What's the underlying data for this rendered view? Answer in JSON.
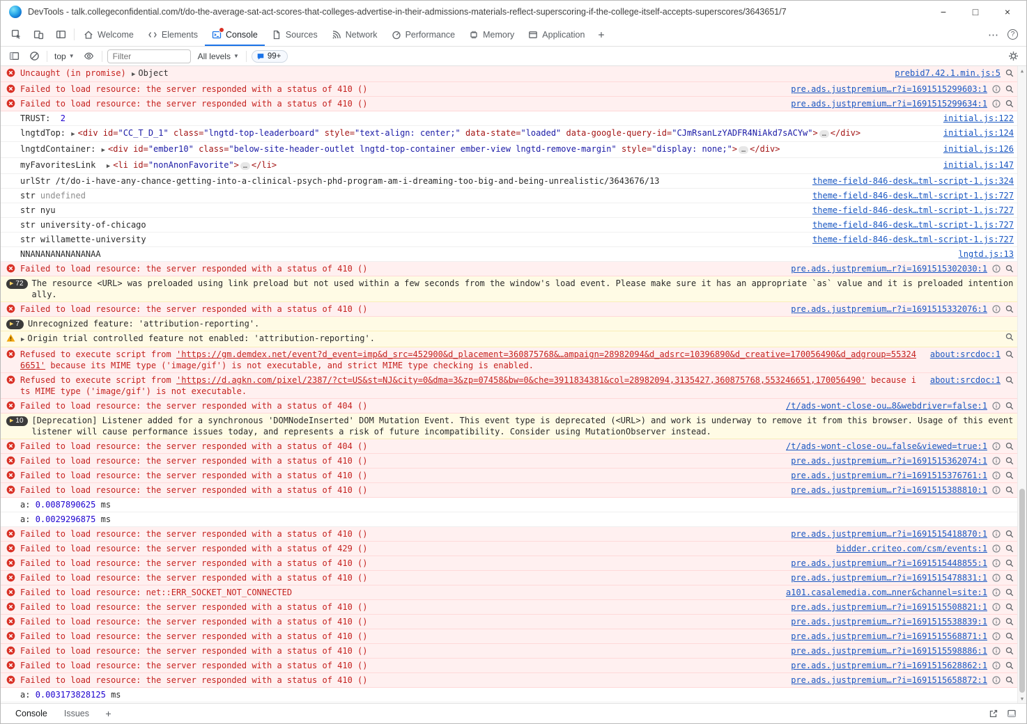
{
  "window": {
    "title": "DevTools - talk.collegeconfidential.com/t/do-the-average-sat-act-scores-that-colleges-advertise-in-their-admissions-materials-reflect-superscoring-if-the-college-itself-accepts-superscores/3643651/7",
    "controls": {
      "minimize": "−",
      "maximize": "□",
      "close": "×"
    }
  },
  "tab_bar": {
    "tabs": [
      {
        "label": "Welcome"
      },
      {
        "label": "Elements"
      },
      {
        "label": "Console"
      },
      {
        "label": "Sources"
      },
      {
        "label": "Network"
      },
      {
        "label": "Performance"
      },
      {
        "label": "Memory"
      },
      {
        "label": "Application"
      }
    ],
    "active_tab": "Console",
    "more_menu": "⋯",
    "help": "?"
  },
  "console_toolbar": {
    "context_selector": "top",
    "filter_placeholder": "Filter",
    "levels_selector": "All levels",
    "issues_count": "99+"
  },
  "drawer": {
    "tabs": [
      {
        "label": "Console"
      },
      {
        "label": "Issues"
      }
    ]
  },
  "console": {
    "messages": [
      {
        "type": "error",
        "icons": [
          "search"
        ],
        "link": "prebid7.42.1.min.js:5",
        "parts": [
          {
            "t": "Uncaught (in promise) ",
            "c": "err"
          },
          {
            "t": "▶",
            "c": "arrow"
          },
          {
            "t": "Object",
            "c": "obj"
          }
        ]
      },
      {
        "type": "error",
        "icons": [
          "info",
          "search"
        ],
        "link": "pre.ads.justpremium…r?i=1691515299603:1",
        "parts": [
          {
            "t": "Failed to load resource: the server responded with a status of 410 ()",
            "c": "err"
          }
        ]
      },
      {
        "type": "error",
        "icons": [
          "info",
          "search"
        ],
        "link": "pre.ads.justpremium…r?i=1691515299634:1",
        "parts": [
          {
            "t": "Failed to load resource: the server responded with a status of 410 ()",
            "c": "err"
          }
        ]
      },
      {
        "type": "log",
        "link": "initial.js:122",
        "parts": [
          {
            "t": "TRUST:  ",
            "c": "plain"
          },
          {
            "t": "2",
            "c": "num"
          }
        ]
      },
      {
        "type": "log",
        "link": "initial.js:124",
        "parts": [
          {
            "t": "lngtdTop: ",
            "c": "plain"
          },
          {
            "t": "▶",
            "c": "arrow"
          },
          {
            "t": "<div id=",
            "c": "html"
          },
          {
            "t": "\"CC_T_D_1\"",
            "c": "val"
          },
          {
            "t": " class=",
            "c": "html"
          },
          {
            "t": "\"lngtd-top-leaderboard\"",
            "c": "val"
          },
          {
            "t": " style=",
            "c": "html"
          },
          {
            "t": "\"text-align: center;\"",
            "c": "val"
          },
          {
            "t": " data-state=",
            "c": "html"
          },
          {
            "t": "\"loaded\"",
            "c": "val"
          },
          {
            "t": " data-google-query-id=",
            "c": "html"
          },
          {
            "t": "\"CJmRsanLzYADFR4NiAkd7sACYw\"",
            "c": "val"
          },
          {
            "t": ">",
            "c": "html"
          },
          {
            "t": "…",
            "c": "ellipsis"
          },
          {
            "t": "</div>",
            "c": "html"
          }
        ]
      },
      {
        "type": "log",
        "link": "initial.js:126",
        "parts": [
          {
            "t": "lngtdContainer: ",
            "c": "plain"
          },
          {
            "t": "▶",
            "c": "arrow"
          },
          {
            "t": "<div id=",
            "c": "html"
          },
          {
            "t": "\"ember10\"",
            "c": "val"
          },
          {
            "t": " class=",
            "c": "html"
          },
          {
            "t": "\"below-site-header-outlet lngtd-top-container ember-view lngtd-remove-margin\"",
            "c": "val"
          },
          {
            "t": " style=",
            "c": "html"
          },
          {
            "t": "\"display: none;\"",
            "c": "val"
          },
          {
            "t": ">",
            "c": "html"
          },
          {
            "t": "…",
            "c": "ellipsis"
          },
          {
            "t": "</div>",
            "c": "html"
          }
        ]
      },
      {
        "type": "log",
        "link": "initial.js:147",
        "parts": [
          {
            "t": "myFavoritesLink  ",
            "c": "plain"
          },
          {
            "t": "▶",
            "c": "arrow"
          },
          {
            "t": "<li id=",
            "c": "html"
          },
          {
            "t": "\"nonAnonFavorite\"",
            "c": "val"
          },
          {
            "t": ">",
            "c": "html"
          },
          {
            "t": "…",
            "c": "ellipsis"
          },
          {
            "t": "</li>",
            "c": "html"
          }
        ]
      },
      {
        "type": "log",
        "link": "theme-field-846-desk…tml-script-1.js:324",
        "parts": [
          {
            "t": "urlStr /t/do-i-have-any-chance-getting-into-a-clinical-psych-phd-program-am-i-dreaming-too-big-and-being-unrealistic/3643676/13",
            "c": "plain"
          }
        ]
      },
      {
        "type": "log",
        "link": "theme-field-846-desk…tml-script-1.js:727",
        "parts": [
          {
            "t": "str ",
            "c": "plain"
          },
          {
            "t": "undefined",
            "c": "gray"
          }
        ]
      },
      {
        "type": "log",
        "link": "theme-field-846-desk…tml-script-1.js:727",
        "parts": [
          {
            "t": "str nyu",
            "c": "plain"
          }
        ]
      },
      {
        "type": "log",
        "link": "theme-field-846-desk…tml-script-1.js:727",
        "parts": [
          {
            "t": "str university-of-chicago",
            "c": "plain"
          }
        ]
      },
      {
        "type": "log",
        "link": "theme-field-846-desk…tml-script-1.js:727",
        "parts": [
          {
            "t": "str willamette-university",
            "c": "plain"
          }
        ]
      },
      {
        "type": "log",
        "link": "lngtd.js:13",
        "parts": [
          {
            "t": "NNANANANANANANAA",
            "c": "plain"
          }
        ]
      },
      {
        "type": "error",
        "icons": [
          "info",
          "search"
        ],
        "link": "pre.ads.justpremium…r?i=1691515302030:1",
        "parts": [
          {
            "t": "Failed to load resource: the server responded with a status of 410 ()",
            "c": "err"
          }
        ]
      },
      {
        "type": "warn",
        "badge": "72",
        "parts": [
          {
            "t": "The resource <URL> was preloaded using link preload but not used within a few seconds from the window's load event. Please make sure it has an appropriate `as` value and it is preloaded intentionally.",
            "c": "plain"
          }
        ]
      },
      {
        "type": "error",
        "icons": [
          "info",
          "search"
        ],
        "link": "pre.ads.justpremium…r?i=1691515332076:1",
        "parts": [
          {
            "t": "Failed to load resource: the server responded with a status of 410 ()",
            "c": "err"
          }
        ]
      },
      {
        "type": "warn",
        "badge": "7",
        "parts": [
          {
            "t": "Unrecognized feature: 'attribution-reporting'.",
            "c": "plain"
          }
        ]
      },
      {
        "type": "warn",
        "icon": "warning",
        "icons": [
          "search"
        ],
        "parts": [
          {
            "t": "▶",
            "c": "arrow"
          },
          {
            "t": "Origin trial controlled feature not enabled: 'attribution-reporting'.",
            "c": "plain"
          }
        ]
      },
      {
        "type": "error",
        "icons": [
          "search"
        ],
        "link": "about:srcdoc:1",
        "parts": [
          {
            "t": "Refused to execute script from ",
            "c": "err"
          },
          {
            "t": "'https://gm.demdex.net/event?d_event=imp&d_src=452900&d_placement=360875768&…ampaign=28982094&d_adsrc=10396890&d_creative=170056490&d_adgroup=553246651'",
            "c": "err-u"
          },
          {
            "t": " because its MIME type ('image/gif') is not executable, and strict MIME type checking is enabled.",
            "c": "err"
          }
        ]
      },
      {
        "type": "error",
        "icons": [
          "search"
        ],
        "link": "about:srcdoc:1",
        "parts": [
          {
            "t": "Refused to execute script from ",
            "c": "err"
          },
          {
            "t": "'https://d.agkn.com/pixel/2387/?ct=US&st=NJ&city=0&dma=3&zp=07458&bw=0&che=3911834381&col=28982094,3135427,360875768,553246651,170056490'",
            "c": "err-u"
          },
          {
            "t": " because its MIME type ('image/gif') is not executable.",
            "c": "err"
          }
        ]
      },
      {
        "type": "error",
        "icons": [
          "info",
          "search"
        ],
        "link": "/t/ads-wont-close-ou…8&webdriver=false:1",
        "parts": [
          {
            "t": "Failed to load resource: the server responded with a status of 404 ()",
            "c": "err"
          }
        ]
      },
      {
        "type": "warn",
        "badge": "10",
        "parts": [
          {
            "t": "[Deprecation] Listener added for a synchronous 'DOMNodeInserted' DOM Mutation Event. This event type is deprecated (<URL>) and work is underway to remove it from this browser. Usage of this event listener will cause performance issues today, and represents a risk of future incompatibility. Consider using MutationObserver instead.",
            "c": "plain"
          }
        ]
      },
      {
        "type": "error",
        "icons": [
          "info",
          "search"
        ],
        "link": "/t/ads-wont-close-ou…false&viewed=true:1",
        "parts": [
          {
            "t": "Failed to load resource: the server responded with a status of 404 ()",
            "c": "err"
          }
        ]
      },
      {
        "type": "error",
        "icons": [
          "info",
          "search"
        ],
        "link": "pre.ads.justpremium…r?i=1691515362074:1",
        "parts": [
          {
            "t": "Failed to load resource: the server responded with a status of 410 ()",
            "c": "err"
          }
        ]
      },
      {
        "type": "error",
        "icons": [
          "info",
          "search"
        ],
        "link": "pre.ads.justpremium…r?i=1691515376761:1",
        "parts": [
          {
            "t": "Failed to load resource: the server responded with a status of 410 ()",
            "c": "err"
          }
        ]
      },
      {
        "type": "error",
        "icons": [
          "info",
          "search"
        ],
        "link": "pre.ads.justpremium…r?i=1691515388810:1",
        "parts": [
          {
            "t": "Failed to load resource: the server responded with a status of 410 ()",
            "c": "err"
          }
        ]
      },
      {
        "type": "log",
        "parts": [
          {
            "t": "a: ",
            "c": "plain"
          },
          {
            "t": "0.0087890625",
            "c": "num"
          },
          {
            "t": " ms",
            "c": "plain"
          }
        ]
      },
      {
        "type": "log",
        "parts": [
          {
            "t": "a: ",
            "c": "plain"
          },
          {
            "t": "0.0029296875",
            "c": "num"
          },
          {
            "t": " ms",
            "c": "plain"
          }
        ]
      },
      {
        "type": "error",
        "icons": [
          "info",
          "search"
        ],
        "link": "pre.ads.justpremium…r?i=1691515418870:1",
        "parts": [
          {
            "t": "Failed to load resource: the server responded with a status of 410 ()",
            "c": "err"
          }
        ]
      },
      {
        "type": "error",
        "icons": [
          "info",
          "search"
        ],
        "link": "bidder.criteo.com/csm/events:1",
        "parts": [
          {
            "t": "Failed to load resource: the server responded with a status of 429 ()",
            "c": "err"
          }
        ]
      },
      {
        "type": "error",
        "icons": [
          "info",
          "search"
        ],
        "link": "pre.ads.justpremium…r?i=1691515448855:1",
        "parts": [
          {
            "t": "Failed to load resource: the server responded with a status of 410 ()",
            "c": "err"
          }
        ]
      },
      {
        "type": "error",
        "icons": [
          "info",
          "search"
        ],
        "link": "pre.ads.justpremium…r?i=1691515478831:1",
        "parts": [
          {
            "t": "Failed to load resource: the server responded with a status of 410 ()",
            "c": "err"
          }
        ]
      },
      {
        "type": "error",
        "icons": [
          "info",
          "search"
        ],
        "link": "a101.casalemedia.com…nner&channel=site:1",
        "parts": [
          {
            "t": "Failed to load resource: net::ERR_SOCKET_NOT_CONNECTED",
            "c": "err"
          }
        ]
      },
      {
        "type": "error",
        "icons": [
          "info",
          "search"
        ],
        "link": "pre.ads.justpremium…r?i=1691515508821:1",
        "parts": [
          {
            "t": "Failed to load resource: the server responded with a status of 410 ()",
            "c": "err"
          }
        ]
      },
      {
        "type": "error",
        "icons": [
          "info",
          "search"
        ],
        "link": "pre.ads.justpremium…r?i=1691515538839:1",
        "parts": [
          {
            "t": "Failed to load resource: the server responded with a status of 410 ()",
            "c": "err"
          }
        ]
      },
      {
        "type": "error",
        "icons": [
          "info",
          "search"
        ],
        "link": "pre.ads.justpremium…r?i=1691515568871:1",
        "parts": [
          {
            "t": "Failed to load resource: the server responded with a status of 410 ()",
            "c": "err"
          }
        ]
      },
      {
        "type": "error",
        "icons": [
          "info",
          "search"
        ],
        "link": "pre.ads.justpremium…r?i=1691515598886:1",
        "parts": [
          {
            "t": "Failed to load resource: the server responded with a status of 410 ()",
            "c": "err"
          }
        ]
      },
      {
        "type": "error",
        "icons": [
          "info",
          "search"
        ],
        "link": "pre.ads.justpremium…r?i=1691515628862:1",
        "parts": [
          {
            "t": "Failed to load resource: the server responded with a status of 410 ()",
            "c": "err"
          }
        ]
      },
      {
        "type": "error",
        "icons": [
          "info",
          "search"
        ],
        "link": "pre.ads.justpremium…r?i=1691515658872:1",
        "parts": [
          {
            "t": "Failed to load resource: the server responded with a status of 410 ()",
            "c": "err"
          }
        ]
      },
      {
        "type": "log",
        "parts": [
          {
            "t": "a: ",
            "c": "plain"
          },
          {
            "t": "0.003173828125",
            "c": "num"
          },
          {
            "t": " ms",
            "c": "plain"
          }
        ]
      }
    ]
  }
}
